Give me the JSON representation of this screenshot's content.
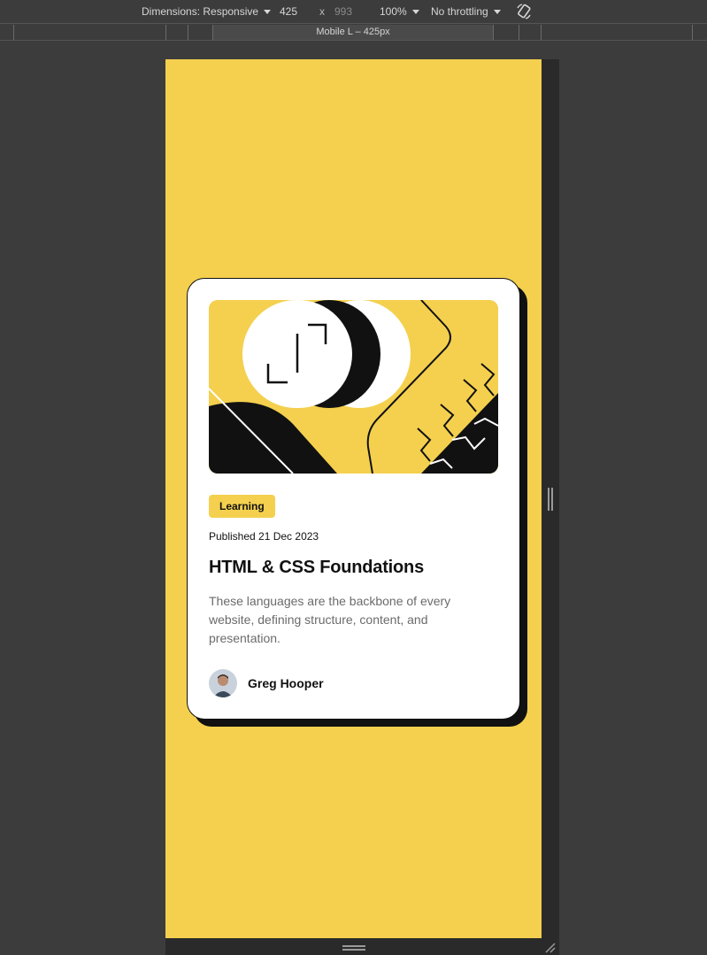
{
  "devtools": {
    "dimensions_label": "Dimensions: Responsive",
    "width": "425",
    "x_sep": "x",
    "height": "993",
    "zoom": "100%",
    "throttling": "No throttling",
    "media_label": "Mobile L – 425px"
  },
  "card": {
    "tag": "Learning",
    "published": "Published 21 Dec 2023",
    "title": "HTML & CSS Foundations",
    "description": "These languages are the backbone of every website, defining structure, content, and presentation.",
    "author": "Greg Hooper"
  },
  "colors": {
    "accent_yellow": "#f4d04e",
    "ink": "#111111",
    "muted": "#6b6b6b"
  }
}
